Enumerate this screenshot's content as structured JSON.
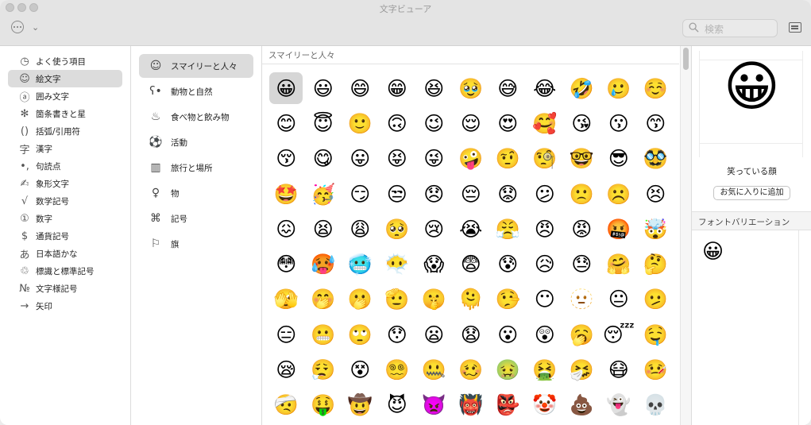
{
  "window": {
    "title": "文字ビューア"
  },
  "toolbar": {
    "more_label": "…",
    "chevron": "⌄"
  },
  "search": {
    "placeholder": "検索"
  },
  "sidebar": {
    "items": [
      {
        "icon": "clock-icon",
        "glyph": "◷",
        "label": "よく使う項目",
        "selected": false
      },
      {
        "icon": "smiley-icon",
        "glyph": "☺",
        "label": "絵文字",
        "selected": true
      },
      {
        "icon": "circled-a-icon",
        "glyph": "ⓐ",
        "label": "囲み文字",
        "selected": false
      },
      {
        "icon": "asterisk-icon",
        "glyph": "✻",
        "label": "箇条書きと星",
        "selected": false
      },
      {
        "icon": "parentheses-icon",
        "glyph": "()",
        "label": "括弧/引用符",
        "selected": false
      },
      {
        "icon": "kanji-icon",
        "glyph": "字",
        "label": "漢字",
        "selected": false
      },
      {
        "icon": "punctuation-icon",
        "glyph": "•,",
        "label": "句読点",
        "selected": false
      },
      {
        "icon": "pictograph-icon",
        "glyph": "✍",
        "label": "象形文字",
        "selected": false
      },
      {
        "icon": "sqrt-icon",
        "glyph": "√",
        "label": "数学記号",
        "selected": false
      },
      {
        "icon": "circled-one-icon",
        "glyph": "①",
        "label": "数字",
        "selected": false
      },
      {
        "icon": "dollar-icon",
        "glyph": "$",
        "label": "通貨記号",
        "selected": false
      },
      {
        "icon": "hiragana-icon",
        "glyph": "あ",
        "label": "日本語かな",
        "selected": false
      },
      {
        "icon": "recycle-icon",
        "glyph": "♲",
        "label": "標識と標準記号",
        "selected": false
      },
      {
        "icon": "numero-icon",
        "glyph": "№",
        "label": "文字様記号",
        "selected": false
      },
      {
        "icon": "arrow-icon",
        "glyph": "→",
        "label": "矢印",
        "selected": false
      }
    ]
  },
  "categories": {
    "items": [
      {
        "icon": "smiley-icon",
        "glyph": "☺",
        "label": "スマイリーと人々",
        "selected": true
      },
      {
        "icon": "bear-icon",
        "glyph": "ʕ•",
        "label": "動物と自然",
        "selected": false
      },
      {
        "icon": "food-icon",
        "glyph": "♨",
        "label": "食べ物と飲み物",
        "selected": false
      },
      {
        "icon": "ball-icon",
        "glyph": "⚽",
        "label": "活動",
        "selected": false
      },
      {
        "icon": "building-icon",
        "glyph": "▥",
        "label": "旅行と場所",
        "selected": false
      },
      {
        "icon": "bulb-icon",
        "glyph": "♀",
        "label": "物",
        "selected": false
      },
      {
        "icon": "symbols-icon",
        "glyph": "⌘",
        "label": "記号",
        "selected": false
      },
      {
        "icon": "flag-icon",
        "glyph": "⚐",
        "label": "旗",
        "selected": false
      }
    ]
  },
  "grid": {
    "header": "スマイリーと人々",
    "selected_index": 0,
    "emojis": [
      "😀",
      "😃",
      "😄",
      "😁",
      "😆",
      "🥹",
      "😅",
      "😂",
      "🤣",
      "🥲",
      "☺️",
      "😊",
      "😇",
      "🙂",
      "🙃",
      "😉",
      "😌",
      "😍",
      "🥰",
      "😘",
      "😗",
      "😙",
      "😚",
      "😋",
      "😛",
      "😝",
      "😜",
      "🤪",
      "🤨",
      "🧐",
      "🤓",
      "😎",
      "🥸",
      "🤩",
      "🥳",
      "😏",
      "😒",
      "😞",
      "😔",
      "😟",
      "😕",
      "🙁",
      "☹️",
      "😣",
      "😖",
      "😫",
      "😩",
      "🥺",
      "😢",
      "😭",
      "😤",
      "😠",
      "😡",
      "🤬",
      "🤯",
      "😳",
      "🥵",
      "🥶",
      "😶‍🌫️",
      "😱",
      "😨",
      "😰",
      "😥",
      "😓",
      "🤗",
      "🤔",
      "🫣",
      "🤭",
      "🫢",
      "🫡",
      "🤫",
      "🫠",
      "🤥",
      "😶",
      "🫥",
      "😐",
      "🫤",
      "😑",
      "😬",
      "🙄",
      "😯",
      "😦",
      "😧",
      "😮",
      "😲",
      "🥱",
      "😴",
      "🤤",
      "😪",
      "😮‍💨",
      "😵",
      "😵‍💫",
      "🤐",
      "🥴",
      "🤢",
      "🤮",
      "🤧",
      "😷",
      "🤒",
      "🤕",
      "🤑",
      "🤠",
      "😈",
      "👿",
      "👹",
      "👺",
      "🤡",
      "💩",
      "👻",
      "💀"
    ]
  },
  "detail": {
    "preview_emoji": "😀",
    "name": "笑っている顔",
    "favorite_button": "お気に入りに追加",
    "variations_title": "フォントバリエーション",
    "variation_emoji": "😀"
  }
}
